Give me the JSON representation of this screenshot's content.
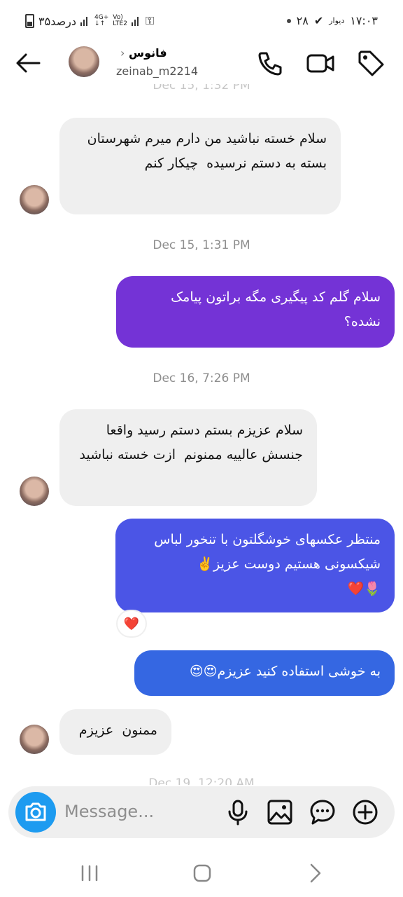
{
  "status_bar": {
    "time": "۱۷:۰۳",
    "carrier": "دیوار",
    "temperature": "۲۸",
    "battery": "۳۵درصد",
    "network_1": "4G+",
    "network_2": "LTE2"
  },
  "header": {
    "name": "فانوس",
    "chevron": "›",
    "handle": "zeinab_m2214"
  },
  "messages": [
    {
      "type": "timestamp",
      "text": "Dec 15, 1:32 PM",
      "faded": true
    },
    {
      "type": "incoming",
      "text": "سلام خسته نباشید من دارم میرم شهرستان بسته به دستم نرسیده  چیکار کنم"
    },
    {
      "type": "timestamp",
      "text": "Dec 15, 1:31 PM"
    },
    {
      "type": "outgoing",
      "text": "سلام گلم کد پیگیری مگه براتون پیامک نشده؟",
      "color": "#7433d6"
    },
    {
      "type": "timestamp",
      "text": "Dec 16, 7:26 PM"
    },
    {
      "type": "incoming",
      "text": "سلام عزیزم بستم دستم رسید واقعا جنسش عالییه ممنونم  ازت خسته نباشید"
    },
    {
      "type": "outgoing",
      "text": "منتظر عکسهای خوشگلتون با تنخور لباس شیکسونی هستیم دوست عزیز✌️\n🌷❤️",
      "color": "#4b55e6",
      "reaction": "❤️"
    },
    {
      "type": "outgoing",
      "text": "به خوشی استفاده کنید عزیزم😍😍",
      "color": "#3567e2"
    },
    {
      "type": "incoming",
      "text": "ممنون  عزیزم"
    },
    {
      "type": "timestamp",
      "text": "Dec 19, 12:20 AM",
      "faded": true
    }
  ],
  "composer": {
    "placeholder": "Message..."
  },
  "colors": {
    "incoming_bg": "#efefef",
    "camera_button": "#1d9bf0",
    "timestamp": "#8e8e8e"
  },
  "icons": [
    "back-arrow-icon",
    "phone-icon",
    "video-icon",
    "tag-icon",
    "camera-icon",
    "microphone-icon",
    "gallery-icon",
    "sticker-icon",
    "plus-icon",
    "recent-apps-icon",
    "home-icon",
    "back-nav-icon"
  ]
}
